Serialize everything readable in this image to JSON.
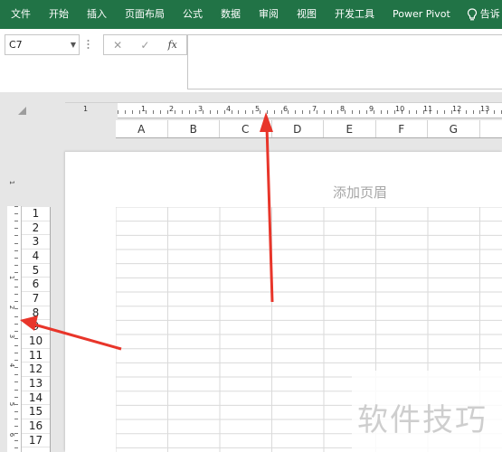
{
  "ribbon": {
    "tabs": [
      "文件",
      "开始",
      "插入",
      "页面布局",
      "公式",
      "数据",
      "审阅",
      "视图",
      "开发工具",
      "Power Pivot"
    ],
    "help_label": "告诉",
    "color": "#217346"
  },
  "formula_bar": {
    "name_box": "C7",
    "cancel_symbol": "✕",
    "enter_symbol": "✓",
    "fx_symbol": "fx",
    "formula": ""
  },
  "ruler": {
    "horizontal_numbers": [
      "1",
      "1",
      "2",
      "3",
      "4",
      "5",
      "6",
      "7",
      "8",
      "9",
      "10",
      "11",
      "12",
      "13"
    ],
    "vertical_numbers": [
      "1",
      "1",
      "2",
      "3",
      "4",
      "5",
      "6"
    ]
  },
  "columns": [
    "A",
    "B",
    "C",
    "D",
    "E",
    "F",
    "G"
  ],
  "rows": [
    "1",
    "2",
    "3",
    "4",
    "5",
    "6",
    "7",
    "8",
    "9",
    "10",
    "11",
    "12",
    "13",
    "14",
    "15",
    "16",
    "17"
  ],
  "page": {
    "header_placeholder": "添加页眉"
  },
  "watermark": "软件技巧",
  "annotation_color": "#e8352a"
}
